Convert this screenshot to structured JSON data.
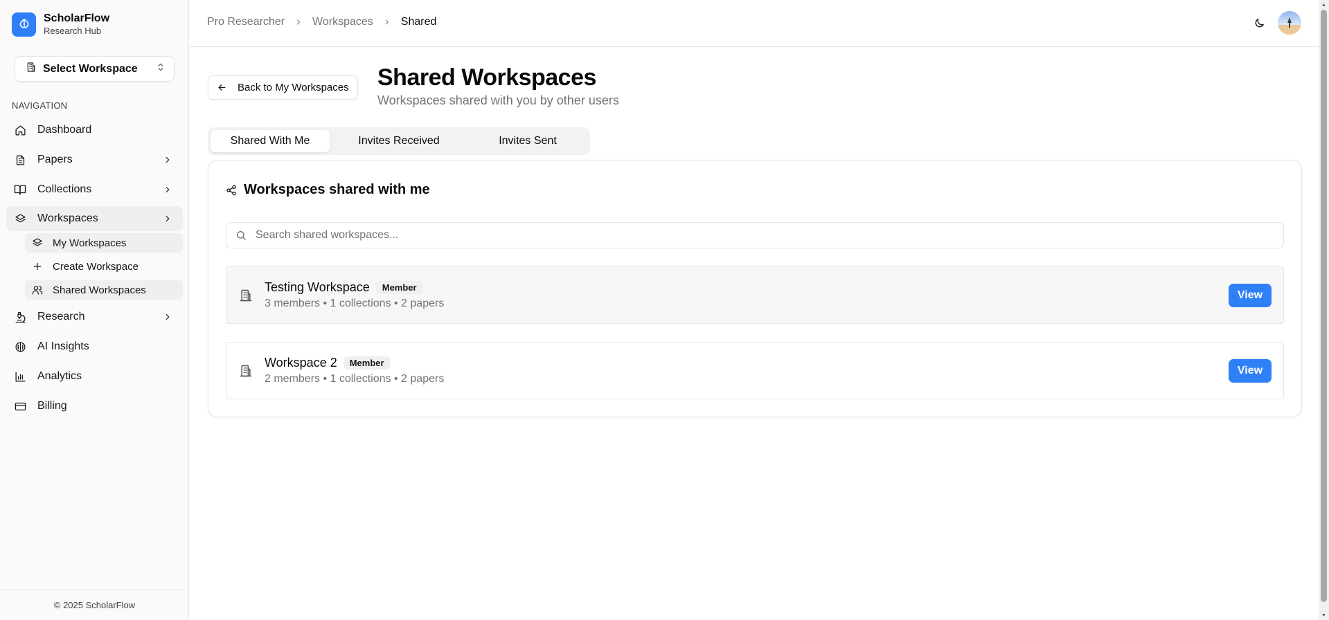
{
  "brand": {
    "name": "ScholarFlow",
    "subtitle": "Research Hub",
    "accent": "#2f80f6"
  },
  "workspace_select": {
    "label": "Select Workspace"
  },
  "nav": {
    "heading": "NAVIGATION",
    "items": [
      {
        "label": "Dashboard",
        "icon": "home-icon"
      },
      {
        "label": "Papers",
        "icon": "file-text-icon"
      },
      {
        "label": "Collections",
        "icon": "book-open-icon"
      },
      {
        "label": "Workspaces",
        "icon": "layers-icon"
      },
      {
        "label": "Research",
        "icon": "microscope-icon"
      },
      {
        "label": "AI Insights",
        "icon": "brain-icon"
      },
      {
        "label": "Analytics",
        "icon": "bar-chart-icon"
      },
      {
        "label": "Billing",
        "icon": "credit-card-icon"
      }
    ],
    "sub_items": [
      {
        "label": "My Workspaces",
        "icon": "layers-icon"
      },
      {
        "label": "Create Workspace",
        "icon": "plus-icon"
      },
      {
        "label": "Shared Workspaces",
        "icon": "users-icon"
      }
    ]
  },
  "footer": {
    "text": "© 2025 ScholarFlow"
  },
  "breadcrumb": [
    "Pro Researcher",
    "Workspaces",
    "Shared"
  ],
  "header": {
    "back_label": "Back to My Workspaces",
    "title": "Shared Workspaces",
    "subtitle": "Workspaces shared with you by other users"
  },
  "tabs": [
    "Shared With Me",
    "Invites Received",
    "Invites Sent"
  ],
  "card": {
    "title": "Workspaces shared with me",
    "search_placeholder": "Search shared workspaces..."
  },
  "workspaces": [
    {
      "name": "Testing Workspace",
      "role": "Member",
      "meta": "3 members • 1 collections • 2 papers",
      "action": "View"
    },
    {
      "name": "Workspace 2",
      "role": "Member",
      "meta": "2 members • 1 collections • 2 papers",
      "action": "View"
    }
  ]
}
